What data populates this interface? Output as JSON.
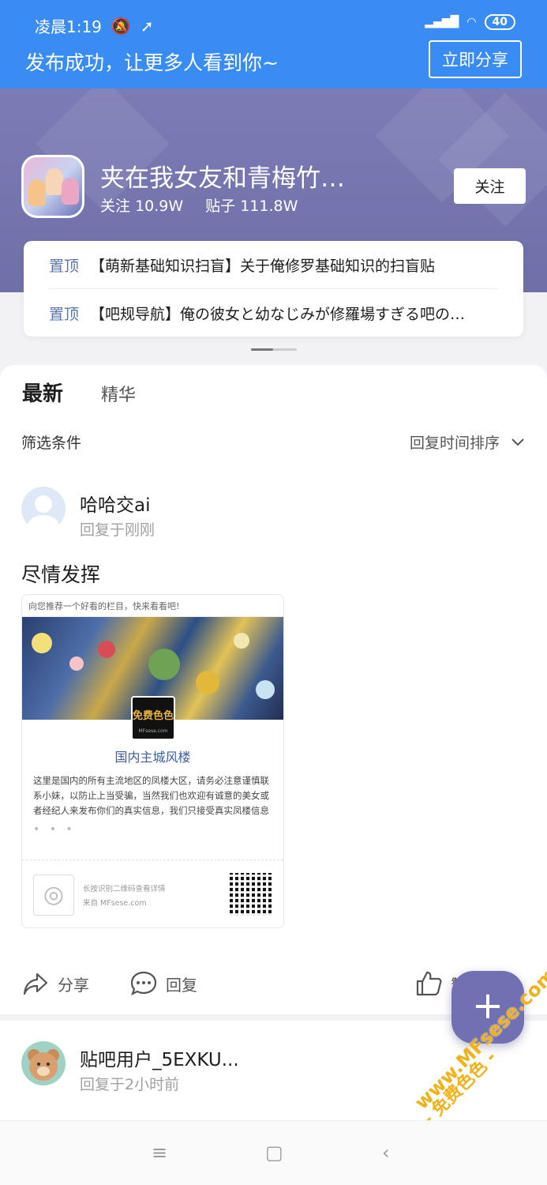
{
  "status_bar": {
    "time": "凌晨1:19",
    "battery": "40"
  },
  "banner": {
    "message": "发布成功，让更多人看到你~",
    "share_button": "立即分享"
  },
  "forum": {
    "name": "夹在我女友和青梅竹…",
    "followers_label": "关注",
    "followers": "10.9W",
    "posts_label": "贴子",
    "posts": "111.8W",
    "follow_button": "关注"
  },
  "pinned": [
    {
      "tag": "置顶",
      "text": "【萌新基础知识扫盲】关于俺修罗基础知识的扫盲贴"
    },
    {
      "tag": "置顶",
      "text": "【吧规导航】俺の彼女と幼なじみが修羅場すぎる吧の…"
    }
  ],
  "tabs": [
    "最新",
    "精华"
  ],
  "filter": {
    "label": "筛选条件",
    "sort": "回复时间排序"
  },
  "post1": {
    "user": "哈哈交ai",
    "time": "回复于刚刚",
    "title": "尽情发挥",
    "card": {
      "head": "向您推荐一个好看的栏目，快来看看吧!",
      "logo": "免费色色",
      "logo_sub": "MFsese.com",
      "title": "国内主城风楼",
      "desc": "这里是国内的所有主流地区的凤楼大区，请务必注意谨慎联系小妹，以防止上当受骗，当然我们也欢迎有诚意的美女或者经纪人来发布你们的真实信息，我们只接受真实凤楼信息",
      "dots": "• • •",
      "hint1": "长按识别二维码查看详情",
      "hint2": "来自 MFsese.com"
    },
    "actions": {
      "share": "分享",
      "reply": "回复",
      "like": "赞"
    }
  },
  "post2": {
    "user": "贴吧用户_5EXKU...",
    "time": "回复于2小时前"
  },
  "watermark": {
    "line1": "- 免费色色 -",
    "line2": "www.MFsese.com"
  },
  "colors": {
    "banner_blue": "#3a8cf5",
    "forum_purple": "#7574ae",
    "fab": "#7070b2",
    "pin_tag": "#5a76a8"
  }
}
